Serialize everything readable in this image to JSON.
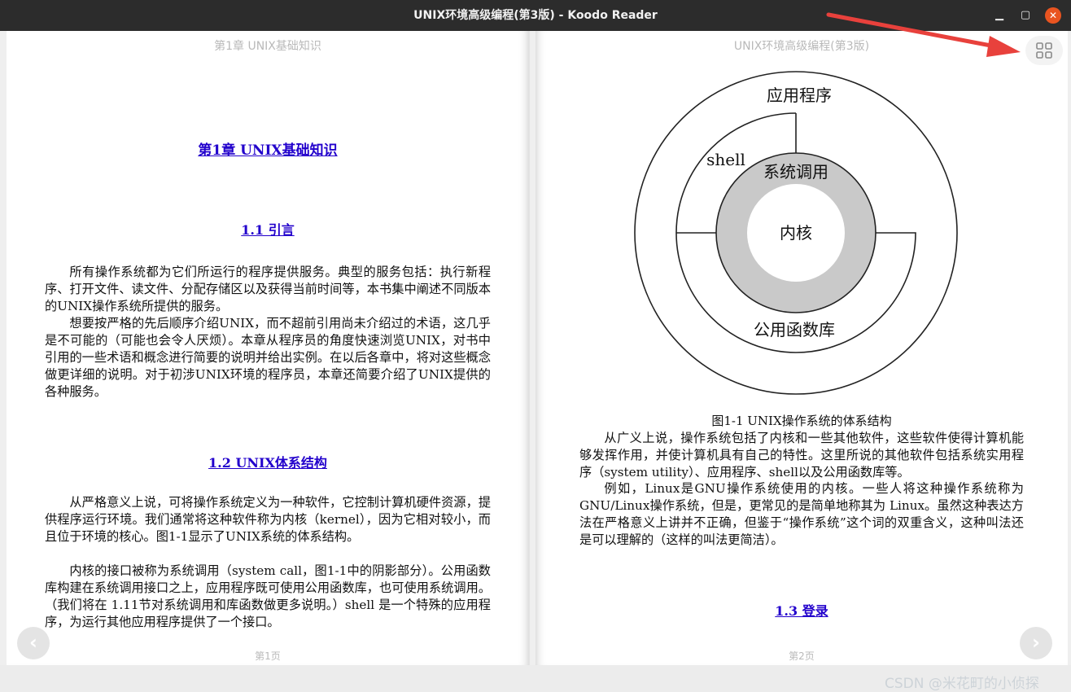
{
  "window": {
    "title": "UNIX环境高级编程(第3版) - Koodo Reader"
  },
  "left_page": {
    "header": "第1章 UNIX基础知识",
    "chapter_title": "第1章 UNIX基础知识",
    "section_1": "1.1 引言",
    "para_1": "所有操作系统都为它们所运行的程序提供服务。典型的服务包括：执行新程序、打开文件、读文件、分配存储区以及获得当前时间等，本书集中阐述不同版本的UNIX操作系统所提供的服务。",
    "para_2": "想要按严格的先后顺序介绍UNIX，而不超前引用尚未介绍过的术语，这几乎是不可能的（可能也会令人厌烦）。本章从程序员的角度快速浏览UNIX，对书中引用的一些术语和概念进行简要的说明并给出实例。在以后各章中，将对这些概念做更详细的说明。对于初涉UNIX环境的程序员，本章还简要介绍了UNIX提供的各种服务。",
    "section_2": "1.2 UNIX体系结构",
    "para_3": "从严格意义上说，可将操作系统定义为一种软件，它控制计算机硬件资源，提供程序运行环境。我们通常将这种软件称为内核（kernel），因为它相对较小，而且位于环境的核心。图1-1显示了UNIX系统的体系结构。",
    "para_4": "内核的接口被称为系统调用（system call，图1-1中的阴影部分）。公用函数库构建在系统调用接口之上，应用程序既可使用公用函数库，也可使用系统调用。（我们将在 1.11节对系统调用和库函数做更多说明。）shell 是一个特殊的应用程序，为运行其他应用程序提供了一个接口。",
    "footer": "第1页"
  },
  "right_page": {
    "header": "UNIX环境高级编程(第3版)",
    "diagram": {
      "outer_label": "应用程序",
      "shell_label": "shell",
      "syscall_label": "系统调用",
      "kernel_label": "内核",
      "library_label": "公用函数库"
    },
    "figure_caption": "图1-1 UNIX操作系统的体系结构",
    "para_1": "从广义上说，操作系统包括了内核和一些其他软件，这些软件使得计算机能够发挥作用，并使计算机具有自己的特性。这里所说的其他软件包括系统实用程序（system utility）、应用程序、shell以及公用函数库等。",
    "para_2": "例如，Linux是GNU操作系统使用的内核。一些人将这种操作系统称为GNU/Linux操作系统，但是，更常见的是简单地称其为 Linux。虽然这种表达方法在严格意义上讲并不正确，但鉴于“操作系统”这个词的双重含义，这种叫法还是可以理解的（这样的叫法更简洁）。",
    "section_3": "1.3 登录",
    "footer": "第2页"
  },
  "controls": {
    "prev_icon": "‹",
    "next_icon": "›",
    "grid_icon": "grid-icon"
  },
  "watermark": "CSDN @米花町的小侦探",
  "colors": {
    "titlebar": "#2c2c2c",
    "heading_link": "#2200cc",
    "close_button": "#e95420",
    "annotation_arrow": "#e8413c",
    "syscall_ring": "#c9c9c9"
  }
}
